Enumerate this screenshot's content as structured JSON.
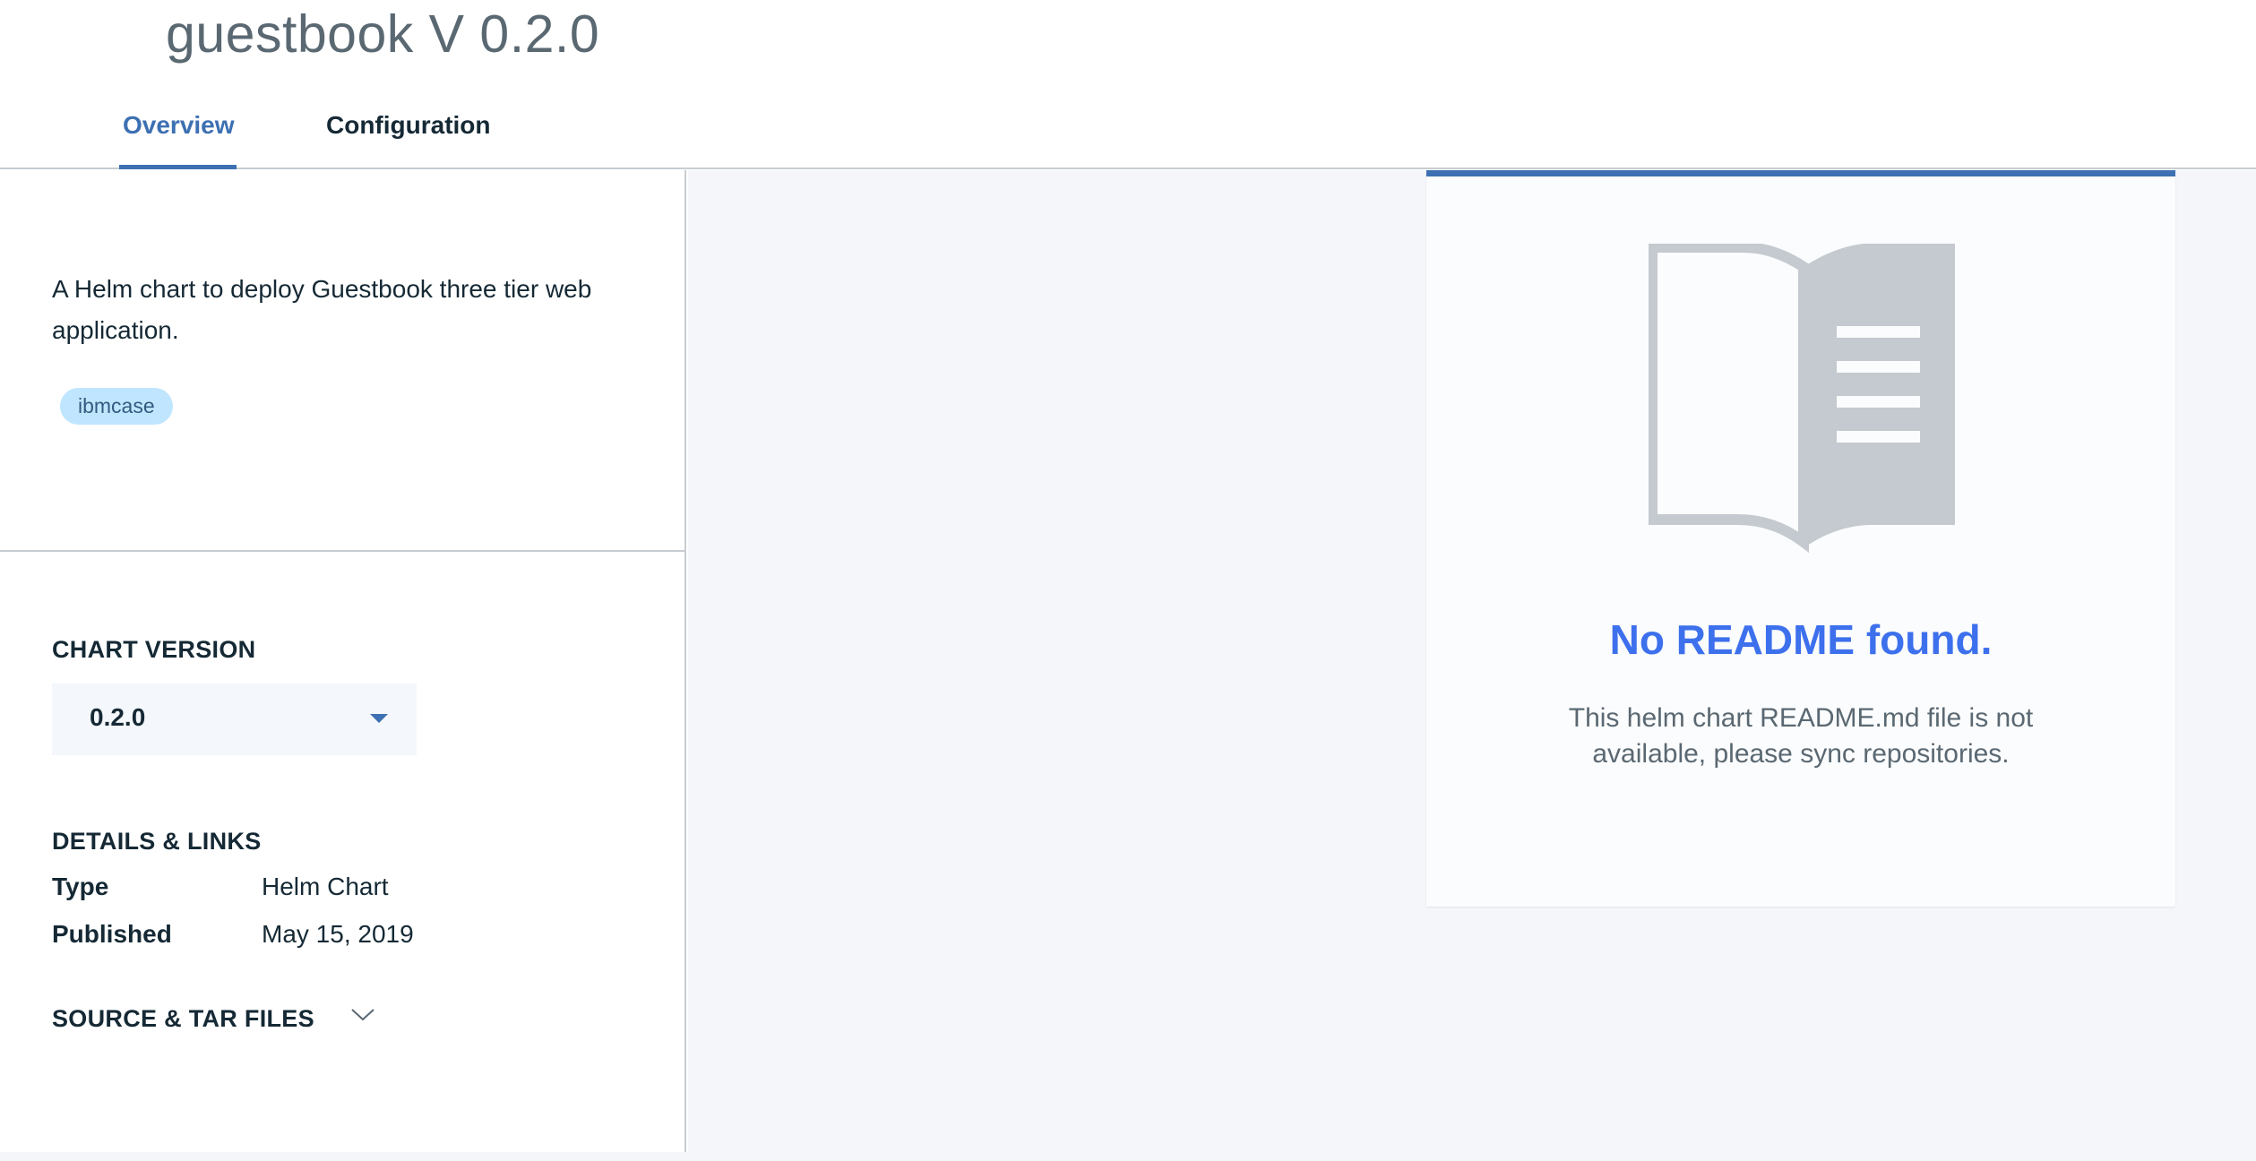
{
  "header": {
    "title": "guestbook V 0.2.0",
    "tabs": [
      {
        "label": "Overview",
        "active": true
      },
      {
        "label": "Configuration",
        "active": false
      }
    ]
  },
  "sidebar": {
    "description": "A Helm chart to deploy Guestbook three tier web application.",
    "tag": "ibmcase",
    "chart_version": {
      "heading": "CHART VERSION",
      "selected": "0.2.0"
    },
    "details": {
      "heading": "DETAILS & LINKS",
      "rows": [
        {
          "label": "Type",
          "value": "Helm Chart"
        },
        {
          "label": "Published",
          "value": "May 15, 2019"
        }
      ]
    },
    "source": {
      "heading": "SOURCE & TAR FILES",
      "icon": "chevron-down-icon"
    }
  },
  "readme": {
    "icon": "open-book-icon",
    "title": "No README found.",
    "message": "This helm chart README.md file is not available, please sync repositories."
  },
  "colors": {
    "accent": "#3d70b2",
    "readme_title": "#3d70ed",
    "tag_bg": "#c0e6ff",
    "panel_bg": "#f4f6fa"
  }
}
